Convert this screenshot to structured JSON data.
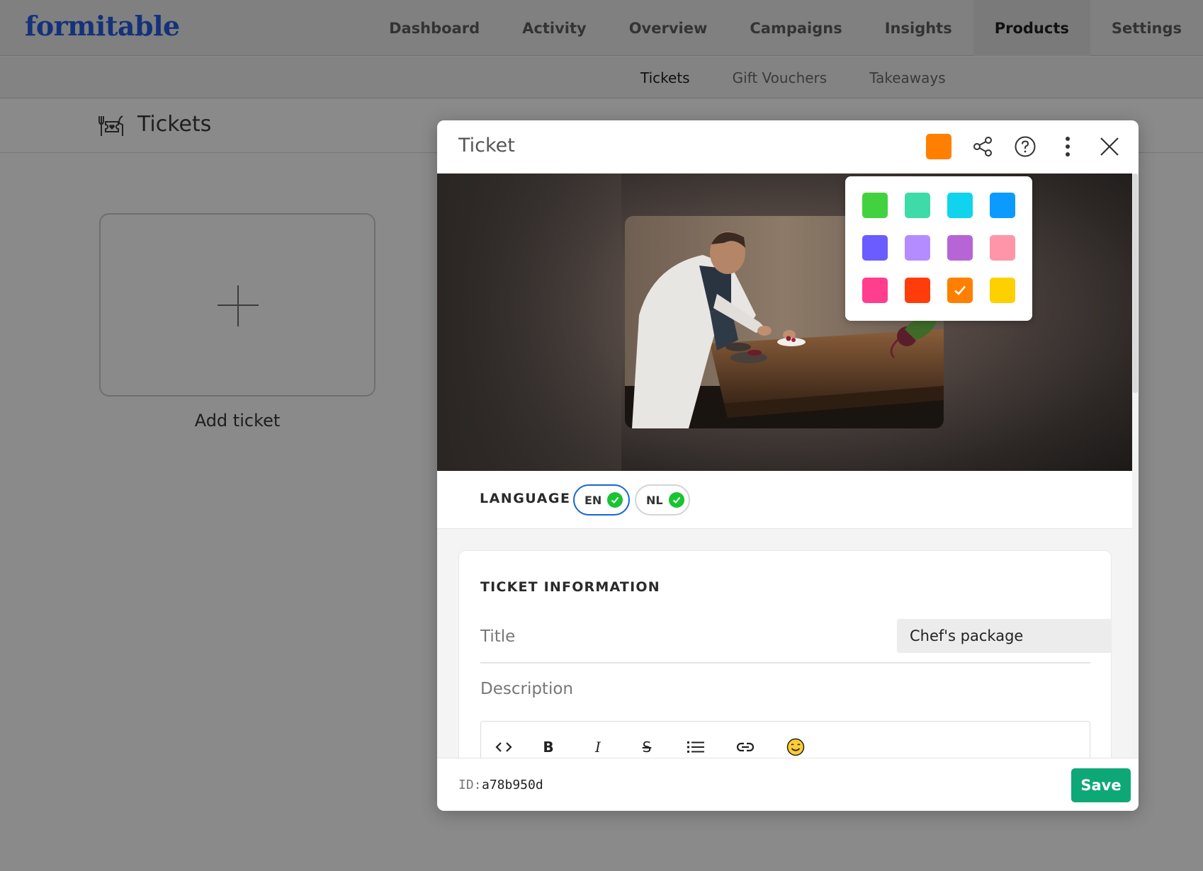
{
  "app": {
    "logo": "formitable"
  },
  "main_nav": [
    {
      "label": "Dashboard",
      "active": false
    },
    {
      "label": "Activity",
      "active": false
    },
    {
      "label": "Overview",
      "active": false
    },
    {
      "label": "Campaigns",
      "active": false
    },
    {
      "label": "Insights",
      "active": false
    },
    {
      "label": "Products",
      "active": true
    },
    {
      "label": "Settings",
      "active": false
    }
  ],
  "sub_nav": [
    {
      "label": "Tickets",
      "active": true
    },
    {
      "label": "Gift Vouchers",
      "active": false
    },
    {
      "label": "Takeaways",
      "active": false
    }
  ],
  "page": {
    "title": "Tickets",
    "icon": "ticket-dining-icon",
    "add_card_label": "Add ticket"
  },
  "modal": {
    "title": "Ticket",
    "selected_color": "#ff7f00",
    "header_icons": [
      "share-icon",
      "help-icon",
      "more-icon",
      "close-icon"
    ],
    "language": {
      "label": "LANGUAGE",
      "options": [
        {
          "code": "EN",
          "selected": true,
          "complete": true
        },
        {
          "code": "NL",
          "selected": false,
          "complete": true
        }
      ]
    },
    "section": {
      "heading": "TICKET INFORMATION",
      "title_label": "Title",
      "title_value": "Chef's package",
      "description_label": "Description"
    },
    "editor_toolbar": [
      "code-icon",
      "bold-icon",
      "italic-icon",
      "strikethrough-icon",
      "list-icon",
      "link-icon",
      "emoji-icon"
    ],
    "footer": {
      "id_label": "ID:",
      "id_value": "a78b950d",
      "save_label": "Save"
    }
  },
  "color_palette": [
    [
      "#43d23f",
      "#3edba8",
      "#10d3ee",
      "#0b9bff"
    ],
    [
      "#6a5cff",
      "#b58cff",
      "#b764d6",
      "#ff95a8"
    ],
    [
      "#ff3e8e",
      "#ff3d0b",
      "#ff7f00",
      "#ffd000"
    ]
  ],
  "selected_palette_color": "#ff7f00"
}
